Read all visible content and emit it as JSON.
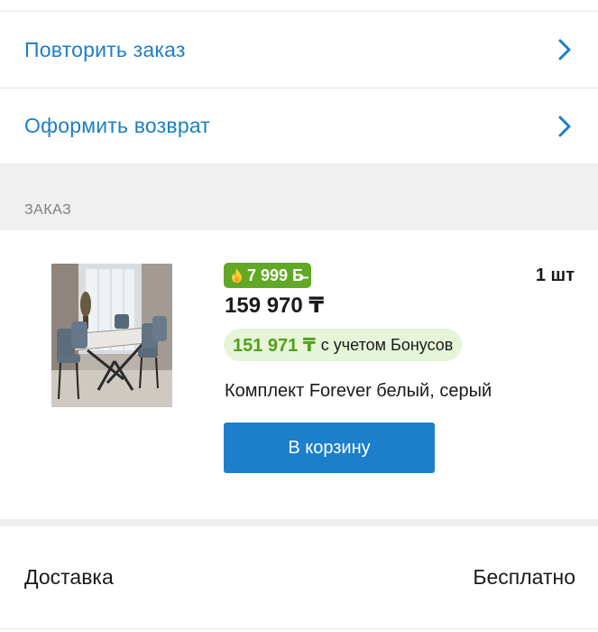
{
  "actions": [
    {
      "label": "Повторить заказ",
      "icon": "chevron-right-icon"
    },
    {
      "label": "Оформить возврат",
      "icon": "chevron-right-icon"
    }
  ],
  "section": {
    "title": "ЗАКАЗ"
  },
  "order_item": {
    "bonus_badge": "7 999 Б̶",
    "bonus_icon": "flame-icon",
    "quantity": "1 шт",
    "price": "159 970 ₸",
    "bonus_price": "151 971 ₸",
    "bonus_note": "с учетом Бонусов",
    "name": "Комплект Forever белый, серый",
    "cart_button": "В корзину"
  },
  "delivery": {
    "label": "Доставка",
    "value": "Бесплатно"
  },
  "colors": {
    "accent": "#1b7fc6",
    "button": "#1b7fcc",
    "bonus_green": "#61a825",
    "bonus_pill_bg": "#e6f4d8",
    "section_bg": "#efefef"
  }
}
